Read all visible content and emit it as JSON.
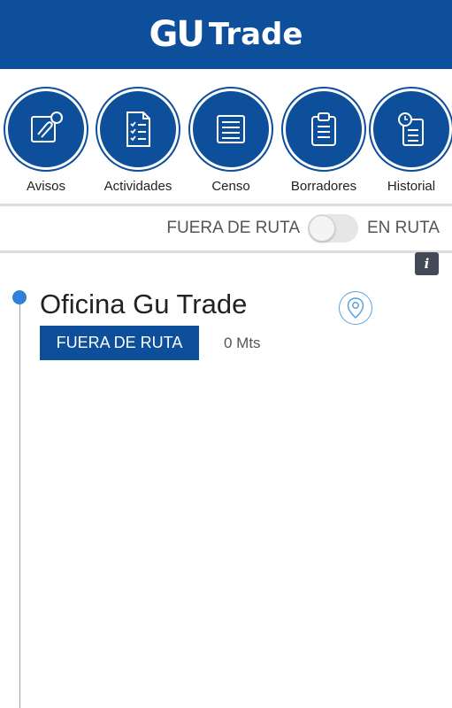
{
  "header": {
    "logo_gu": "GU",
    "logo_trade": "Trade"
  },
  "menu": [
    {
      "label": "Avisos",
      "icon": "edit-notification-icon"
    },
    {
      "label": "Actividades",
      "icon": "checklist-icon"
    },
    {
      "label": "Censo",
      "icon": "list-document-icon"
    },
    {
      "label": "Borradores",
      "icon": "clipboard-icon"
    },
    {
      "label": "Historial",
      "icon": "history-document-icon"
    }
  ],
  "route_toggle": {
    "left_label": "FUERA DE RUTA",
    "right_label": "EN RUTA",
    "state": "off"
  },
  "info_button": {
    "label": "i"
  },
  "visits": [
    {
      "name": "Oficina Gu Trade",
      "status": "FUERA DE RUTA",
      "distance": "0 Mts"
    }
  ],
  "colors": {
    "brand_blue": "#0e4f9b",
    "timeline_dot": "#2f80d8",
    "pin_outline": "#5aa2dd"
  }
}
